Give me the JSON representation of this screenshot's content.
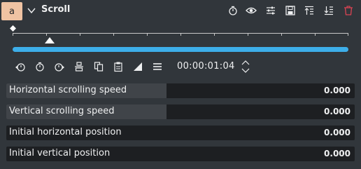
{
  "header": {
    "badge": "a",
    "title": "Scroll"
  },
  "timeline": {
    "playhead_fraction": 0.11
  },
  "toolbar": {
    "timecode": "00:00:01:04"
  },
  "params": [
    {
      "label": "Horizontal scrolling speed",
      "value": "0.000",
      "level": 0.46
    },
    {
      "label": "Vertical scrolling speed",
      "value": "0.000",
      "level": 0.46
    },
    {
      "label": "Initial horizontal position",
      "value": "0.000",
      "level": 0
    },
    {
      "label": "Initial vertical position",
      "value": "0.000",
      "level": 0
    }
  ],
  "colors": {
    "background": "#31363b",
    "accent": "#3daee9",
    "badge": "#f0c3a3",
    "delete": "#da4453"
  }
}
